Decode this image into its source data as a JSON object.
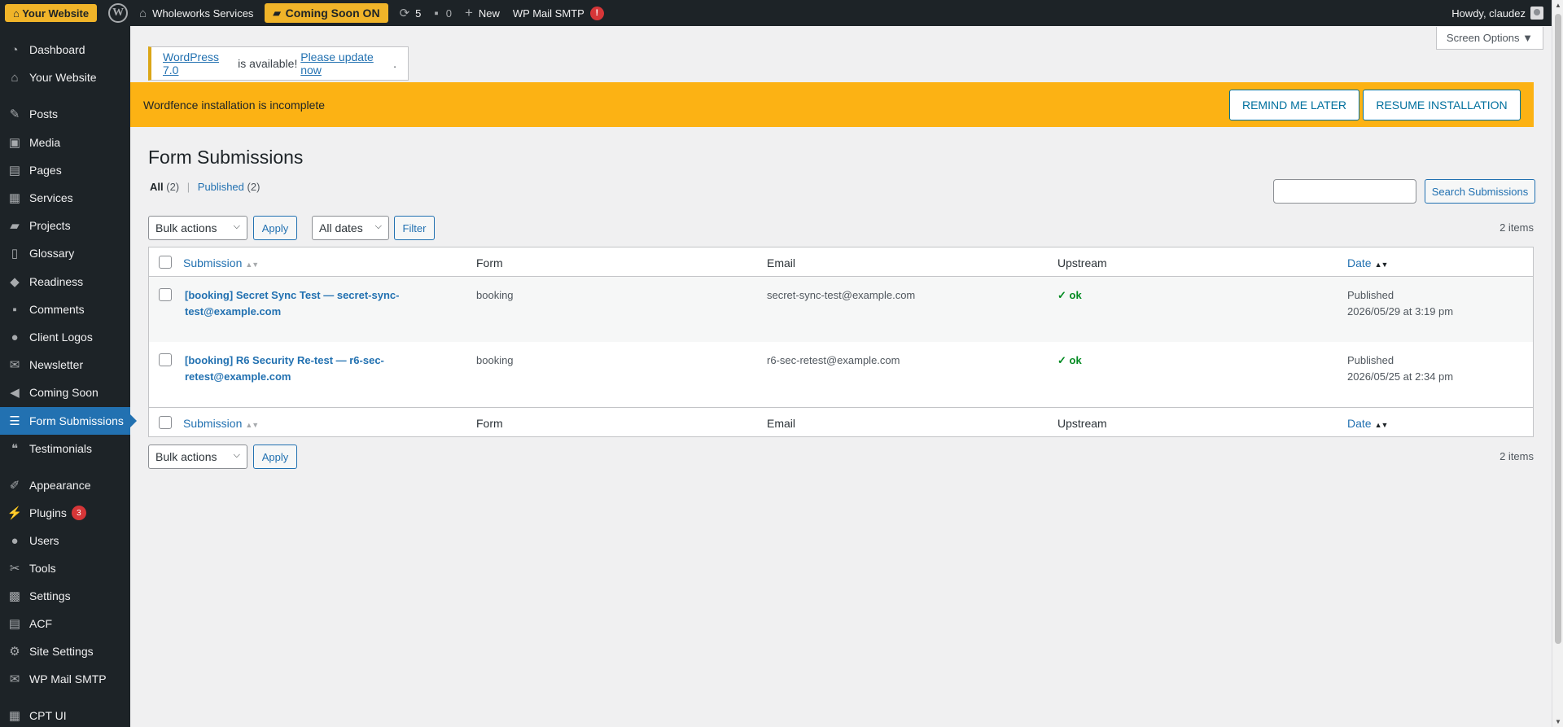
{
  "adminbar": {
    "site_button": "⌂ Your Website",
    "site_name": "Wholeworks Services",
    "coming_soon": "Coming Soon ON",
    "updates_count": "5",
    "comments_count": "0",
    "new_label": "New",
    "smtp_label": "WP Mail SMTP",
    "smtp_alert": "!",
    "howdy": "Howdy, claudez"
  },
  "sidebar": {
    "items": [
      {
        "label": "Dashboard",
        "icon": "dashboard-icon"
      },
      {
        "label": "Your Website",
        "icon": "home-icon"
      },
      {
        "label": "Posts",
        "icon": "pin-icon"
      },
      {
        "label": "Media",
        "icon": "media-icon"
      },
      {
        "label": "Pages",
        "icon": "pages-icon"
      },
      {
        "label": "Services",
        "icon": "grid-icon"
      },
      {
        "label": "Projects",
        "icon": "folder-icon"
      },
      {
        "label": "Glossary",
        "icon": "book-icon"
      },
      {
        "label": "Readiness",
        "icon": "tag-icon"
      },
      {
        "label": "Comments",
        "icon": "comment-icon"
      },
      {
        "label": "Client Logos",
        "icon": "person-icon"
      },
      {
        "label": "Newsletter",
        "icon": "mail-icon"
      },
      {
        "label": "Coming Soon",
        "icon": "megaphone-icon"
      },
      {
        "label": "Form Submissions",
        "icon": "form-icon"
      },
      {
        "label": "Testimonials",
        "icon": "quote-icon"
      },
      {
        "label": "Appearance",
        "icon": "brush-icon"
      },
      {
        "label": "Plugins",
        "icon": "plugin-icon",
        "badge": "3"
      },
      {
        "label": "Users",
        "icon": "users-icon"
      },
      {
        "label": "Tools",
        "icon": "wrench-icon"
      },
      {
        "label": "Settings",
        "icon": "settings-icon"
      },
      {
        "label": "ACF",
        "icon": "acf-icon"
      },
      {
        "label": "Site Settings",
        "icon": "gear-icon"
      },
      {
        "label": "WP Mail SMTP",
        "icon": "smtp-icon"
      },
      {
        "label": "CPT UI",
        "icon": "cptui-icon"
      }
    ]
  },
  "screen_options": "Screen Options ▼",
  "update_nag": {
    "link1": "WordPress 7.0",
    "middle": " is available! ",
    "link2": "Please update now",
    "end": "."
  },
  "wordfence": {
    "message": "Wordfence installation is incomplete",
    "remind_label": "REMIND ME LATER",
    "resume_label": "RESUME INSTALLATION"
  },
  "page": {
    "title": "Form Submissions",
    "filter_all": "All",
    "filter_all_count": "(2)",
    "filter_sep": "|",
    "filter_published": "Published",
    "filter_published_count": "(2)",
    "search_button": "Search Submissions",
    "search_value": "",
    "bulk_actions": "Bulk actions",
    "apply": "Apply",
    "all_dates": "All dates",
    "filter_button": "Filter",
    "items_count": "2 items"
  },
  "table": {
    "columns": {
      "submission": "Submission",
      "form": "Form",
      "email": "Email",
      "upstream": "Upstream",
      "date": "Date"
    },
    "rows": [
      {
        "title": "[booking] Secret Sync Test — secret-sync-test@example.com",
        "form": "booking",
        "email": "secret-sync-test@example.com",
        "upstream": "✓ ok",
        "status": "Published",
        "date": "2026/05/29 at 3:19 pm"
      },
      {
        "title": "[booking] R6 Security Re-test — r6-sec-retest@example.com",
        "form": "booking",
        "email": "r6-sec-retest@example.com",
        "upstream": "✓ ok",
        "status": "Published",
        "date": "2026/05/25 at 2:34 pm"
      }
    ]
  }
}
